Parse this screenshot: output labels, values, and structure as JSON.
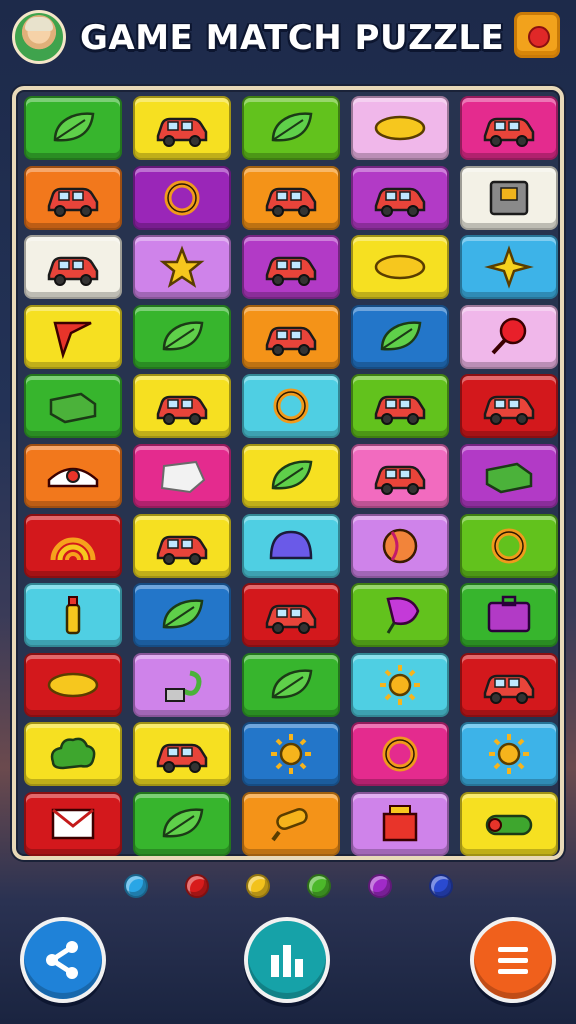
{
  "header": {
    "title": "GAME MATCH PUZZLE"
  },
  "colors": {
    "green": "#37b52d",
    "yellow": "#f6e021",
    "lime": "#62c21d",
    "pink": "#f0b7ea",
    "magenta": "#e42b8e",
    "orange": "#f2781c",
    "purple": "#9a26b8",
    "orange2": "#f49318",
    "violet": "#b23ac6",
    "white": "#f3f1e6",
    "lilac": "#cf83ea",
    "sky": "#3db3e8",
    "blue": "#2376c9",
    "red": "#d3181c",
    "cyan": "#4fcfe3",
    "rose": "#f26bbf"
  },
  "grid": [
    [
      {
        "color": "green",
        "icon": "leaf-icon"
      },
      {
        "color": "yellow",
        "icon": "car-icon"
      },
      {
        "color": "lime",
        "icon": "leaf-icon"
      },
      {
        "color": "pink",
        "icon": "lemon-icon"
      },
      {
        "color": "magenta",
        "icon": "car-icon"
      }
    ],
    [
      {
        "color": "orange",
        "icon": "car-icon"
      },
      {
        "color": "purple",
        "icon": "ring-icon"
      },
      {
        "color": "orange2",
        "icon": "car-icon"
      },
      {
        "color": "violet",
        "icon": "car-icon"
      },
      {
        "color": "white",
        "icon": "robot-icon"
      }
    ],
    [
      {
        "color": "white",
        "icon": "car-icon"
      },
      {
        "color": "lilac",
        "icon": "star-icon"
      },
      {
        "color": "violet",
        "icon": "car-icon"
      },
      {
        "color": "yellow",
        "icon": "lemon-icon"
      },
      {
        "color": "sky",
        "icon": "sparkle-icon"
      }
    ],
    [
      {
        "color": "yellow",
        "icon": "flag-icon"
      },
      {
        "color": "green",
        "icon": "leaf-icon"
      },
      {
        "color": "orange2",
        "icon": "car-icon"
      },
      {
        "color": "blue",
        "icon": "leaf-icon"
      },
      {
        "color": "pink",
        "icon": "lollipop-icon"
      }
    ],
    [
      {
        "color": "green",
        "icon": "box-icon"
      },
      {
        "color": "yellow",
        "icon": "car-icon"
      },
      {
        "color": "cyan",
        "icon": "ring-icon"
      },
      {
        "color": "lime",
        "icon": "car-icon"
      },
      {
        "color": "red",
        "icon": "car-icon"
      }
    ],
    [
      {
        "color": "orange",
        "icon": "eye-icon"
      },
      {
        "color": "magenta",
        "icon": "gem-icon"
      },
      {
        "color": "yellow",
        "icon": "leaf-icon"
      },
      {
        "color": "rose",
        "icon": "car-icon"
      },
      {
        "color": "violet",
        "icon": "box-icon"
      }
    ],
    [
      {
        "color": "red",
        "icon": "rainbow-icon"
      },
      {
        "color": "yellow",
        "icon": "car-icon"
      },
      {
        "color": "cyan",
        "icon": "dome-icon"
      },
      {
        "color": "lilac",
        "icon": "ball-icon"
      },
      {
        "color": "lime",
        "icon": "ring-icon"
      }
    ],
    [
      {
        "color": "cyan",
        "icon": "bottle-icon"
      },
      {
        "color": "blue",
        "icon": "leaf-icon"
      },
      {
        "color": "red",
        "icon": "car-icon"
      },
      {
        "color": "lime",
        "icon": "flower-icon"
      },
      {
        "color": "green",
        "icon": "bag-icon"
      }
    ],
    [
      {
        "color": "red",
        "icon": "lemon-icon"
      },
      {
        "color": "lilac",
        "icon": "hook-icon"
      },
      {
        "color": "green",
        "icon": "leaf-icon"
      },
      {
        "color": "cyan",
        "icon": "sun-icon"
      },
      {
        "color": "red",
        "icon": "car-icon"
      }
    ],
    [
      {
        "color": "yellow",
        "icon": "bush-icon"
      },
      {
        "color": "yellow",
        "icon": "car-icon"
      },
      {
        "color": "blue",
        "icon": "sun-icon"
      },
      {
        "color": "magenta",
        "icon": "ring-icon"
      },
      {
        "color": "sky",
        "icon": "sun-icon"
      }
    ],
    [
      {
        "color": "red",
        "icon": "envelope-icon"
      },
      {
        "color": "green",
        "icon": "leaf-icon"
      },
      {
        "color": "orange2",
        "icon": "popsicle-icon"
      },
      {
        "color": "lilac",
        "icon": "cart-icon"
      },
      {
        "color": "yellow",
        "icon": "tube-icon"
      }
    ]
  ],
  "indicator_dots": [
    "#2aa6e6",
    "#d81c1c",
    "#f2c21c",
    "#4cb82a",
    "#a02ac8",
    "#2a4ad0"
  ],
  "buttons": {
    "share": "share-icon",
    "stats": "stats-icon",
    "menu": "menu-icon"
  }
}
